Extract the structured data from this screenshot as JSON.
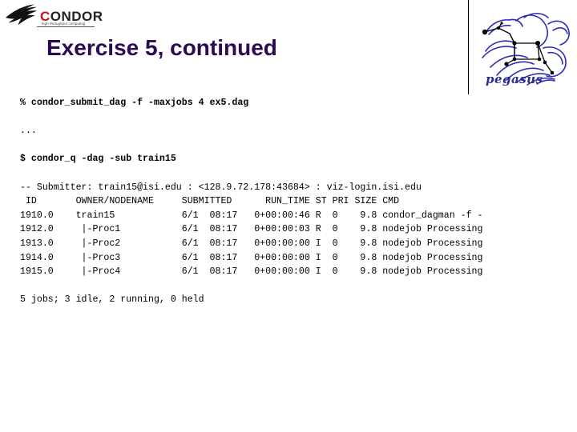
{
  "slide": {
    "title": "Exercise 5, continued"
  },
  "condor_logo": {
    "name": "condor-logo",
    "word_c": "C",
    "word_rest": "ONDOR",
    "tagline": "high throughput computing",
    "color_red": "#cc1111",
    "color_dark": "#222222"
  },
  "pegasus_logo": {
    "name": "pegasus-logo",
    "label": "pegasus",
    "color": "#2b2b8f"
  },
  "console": {
    "lines": [
      {
        "type": "cmd",
        "text": "% condor_submit_dag -f -maxjobs 4 ex5.dag"
      },
      {
        "type": "blank",
        "text": ""
      },
      {
        "type": "out",
        "text": "..."
      },
      {
        "type": "blank",
        "text": ""
      },
      {
        "type": "cmd",
        "text": "$ condor_q -dag -sub train15"
      },
      {
        "type": "blank",
        "text": ""
      },
      {
        "type": "out",
        "text": "-- Submitter: train15@isi.edu : <128.9.72.178:43684> : viz-login.isi.edu"
      },
      {
        "type": "out",
        "text": " ID       OWNER/NODENAME     SUBMITTED      RUN_TIME ST PRI SIZE CMD"
      },
      {
        "type": "out",
        "text": "1910.0    train15            6/1  08:17   0+00:00:46 R  0    9.8 condor_dagman -f -"
      },
      {
        "type": "out",
        "text": "1912.0     |-Proc1           6/1  08:17   0+00:00:03 R  0    9.8 nodejob Processing"
      },
      {
        "type": "out",
        "text": "1913.0     |-Proc2           6/1  08:17   0+00:00:00 I  0    9.8 nodejob Processing"
      },
      {
        "type": "out",
        "text": "1914.0     |-Proc3           6/1  08:17   0+00:00:00 I  0    9.8 nodejob Processing"
      },
      {
        "type": "out",
        "text": "1915.0     |-Proc4           6/1  08:17   0+00:00:00 I  0    9.8 nodejob Processing"
      },
      {
        "type": "blank",
        "text": ""
      },
      {
        "type": "out",
        "text": "5 jobs; 3 idle, 2 running, 0 held"
      }
    ],
    "table": {
      "headers": [
        "ID",
        "OWNER/NODENAME",
        "SUBMITTED",
        "RUN_TIME",
        "ST",
        "PRI",
        "SIZE",
        "CMD"
      ],
      "rows": [
        {
          "id": "1910.0",
          "owner": "train15",
          "submitted": "6/1  08:17",
          "run_time": "0+00:00:46",
          "st": "R",
          "pri": "0",
          "size": "9.8",
          "cmd": "condor_dagman -f -"
        },
        {
          "id": "1912.0",
          "owner": "|-Proc1",
          "submitted": "6/1  08:17",
          "run_time": "0+00:00:03",
          "st": "R",
          "pri": "0",
          "size": "9.8",
          "cmd": "nodejob Processing"
        },
        {
          "id": "1913.0",
          "owner": "|-Proc2",
          "submitted": "6/1  08:17",
          "run_time": "0+00:00:00",
          "st": "I",
          "pri": "0",
          "size": "9.8",
          "cmd": "nodejob Processing"
        },
        {
          "id": "1914.0",
          "owner": "|-Proc3",
          "submitted": "6/1  08:17",
          "run_time": "0+00:00:00",
          "st": "I",
          "pri": "0",
          "size": "9.8",
          "cmd": "nodejob Processing"
        },
        {
          "id": "1915.0",
          "owner": "|-Proc4",
          "submitted": "6/1  08:17",
          "run_time": "0+00:00:00",
          "st": "I",
          "pri": "0",
          "size": "9.8",
          "cmd": "nodejob Processing"
        }
      ],
      "summary": "5 jobs; 3 idle, 2 running, 0 held"
    }
  }
}
